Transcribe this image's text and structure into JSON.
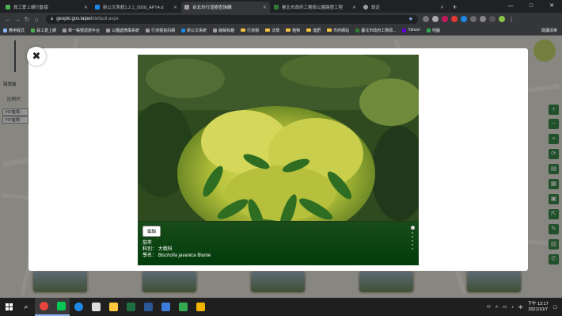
{
  "browser": {
    "tabs": [
      {
        "title": "員工愛上網行動版",
        "color": "#4caf50",
        "active": false
      },
      {
        "title": "新公文系統1.2.1_0928_APT4.d",
        "color": "#1e88e5",
        "active": false
      },
      {
        "title": "台北市行道樹查詢網",
        "color": "#9e9e9e",
        "active": true
      },
      {
        "title": "臺北市政府工務局公園路燈工程",
        "color": "#2e7d32",
        "active": false
      },
      {
        "title": "設定",
        "color": "#9aa0a6",
        "active": false
      }
    ],
    "new_tab": "+",
    "window_controls": [
      "—",
      "□",
      "✕"
    ],
    "url_host": "geopkl.gov.taipei",
    "url_path": "/default.aspx",
    "bookmarks": [
      {
        "label": "應用程式",
        "kind": "app"
      },
      {
        "label": "員工愛上網",
        "kind": "site"
      },
      {
        "label": "單一帳號認證平台",
        "kind": "site"
      },
      {
        "label": "公園處微風系統",
        "kind": "site"
      },
      {
        "label": "行道樹資訊網",
        "kind": "site"
      },
      {
        "label": "新公文系統",
        "kind": "site"
      },
      {
        "label": "破解有趣",
        "kind": "site"
      },
      {
        "label": "行道樹",
        "kind": "folder"
      },
      {
        "label": "法規",
        "kind": "folder"
      },
      {
        "label": "植物",
        "kind": "folder"
      },
      {
        "label": "進肥",
        "kind": "folder"
      },
      {
        "label": "市府網站",
        "kind": "folder"
      },
      {
        "label": "臺北市政府工務局...",
        "kind": "site"
      },
      {
        "label": "Yahoo!",
        "kind": "site"
      },
      {
        "label": "地圖",
        "kind": "site"
      }
    ],
    "bookmarks_right": "閱讀清單"
  },
  "map": {
    "left_labels": [
      "路燈盤",
      "比例尺："
    ],
    "coord_labels": [
      "X97座標：",
      "Y97座標："
    ],
    "right_controls": [
      "+",
      "−",
      "⌖",
      "⟳",
      "▤",
      "▦",
      "▣",
      "⇱",
      "✎",
      "▥",
      "✆"
    ]
  },
  "modal": {
    "close_label": "✖",
    "edit_label": "編輯",
    "common_name": "茄苳",
    "family_label": "科別：",
    "family_value": "大戟科",
    "sci_label": "學名：",
    "sci_genus_species": "Bischofia javanica",
    "sci_author": "Blume"
  },
  "taskbar": {
    "time": "下午 12:17",
    "date": "2021/10/7",
    "apps": [
      {
        "name": "search",
        "color": "#ffffff"
      },
      {
        "name": "chrome",
        "color": "#e8453c"
      },
      {
        "name": "line",
        "color": "#06c755"
      },
      {
        "name": "ie",
        "color": "#1e88e5"
      },
      {
        "name": "file-explorer",
        "color": "#ffc83d"
      },
      {
        "name": "excel",
        "color": "#1d6f42"
      },
      {
        "name": "word",
        "color": "#2b5797"
      },
      {
        "name": "app-blue",
        "color": "#3d7bd9"
      },
      {
        "name": "app-green",
        "color": "#35a852"
      },
      {
        "name": "app-yellow",
        "color": "#f0b400"
      }
    ]
  }
}
